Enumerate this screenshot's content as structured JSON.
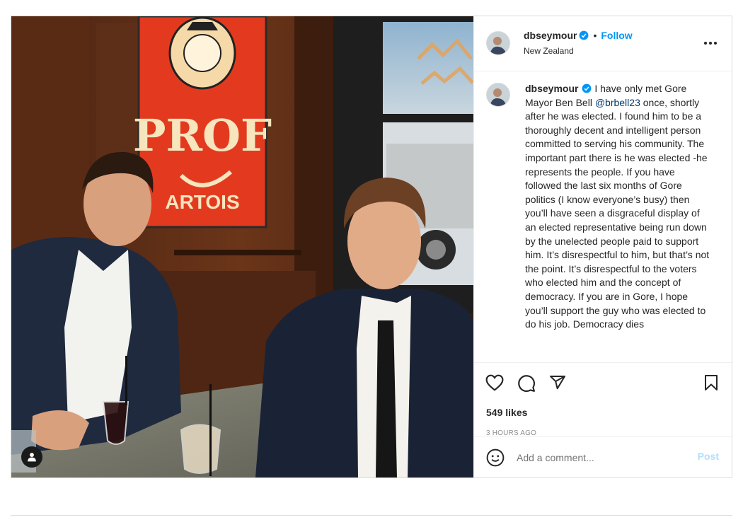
{
  "post": {
    "author": {
      "username": "dbseymour",
      "verified": true,
      "location": "New Zealand"
    },
    "header": {
      "separator": "•",
      "follow_label": "Follow"
    },
    "photo": {
      "sign_title": "PROF",
      "sign_subtitle": "ARTOIS"
    },
    "caption": {
      "username": "dbseymour",
      "text_before_mention": " I have only met Gore Mayor Ben Bell ",
      "mention": "@brbell23",
      "text_after_mention": " once, shortly after he was elected. I found him to be a thoroughly decent and intelligent person committed to serving his community. The important part there is he was elected -he represents the people. If you have followed the last six months of Gore politics (I know everyone’s busy) then you’ll have seen a disgraceful display of an elected representative being run down by the unelected people paid to support him. It’s disrespectful to him, but that’s not the point. It’s disrespectful to the voters who elected him and the concept of democracy. If you are in Gore, I hope you’ll support the guy who was elected to do his job. Democracy dies"
    },
    "stats": {
      "likes": "549 likes",
      "time": "3 HOURS AGO"
    },
    "comment_form": {
      "placeholder": "Add a comment...",
      "post_label": "Post"
    },
    "icons": {
      "like": "heart-icon",
      "comment": "comment-icon",
      "share": "share-icon",
      "save": "bookmark-icon",
      "more": "more-options-icon",
      "emoji": "emoji-icon",
      "tagged": "user-tag-icon",
      "verified": "verified-badge-icon"
    },
    "colors": {
      "accent": "#0095f6",
      "verified": "#0095f6",
      "post_disabled": "#b2dffc",
      "sign_red": "#e33a1f"
    }
  }
}
